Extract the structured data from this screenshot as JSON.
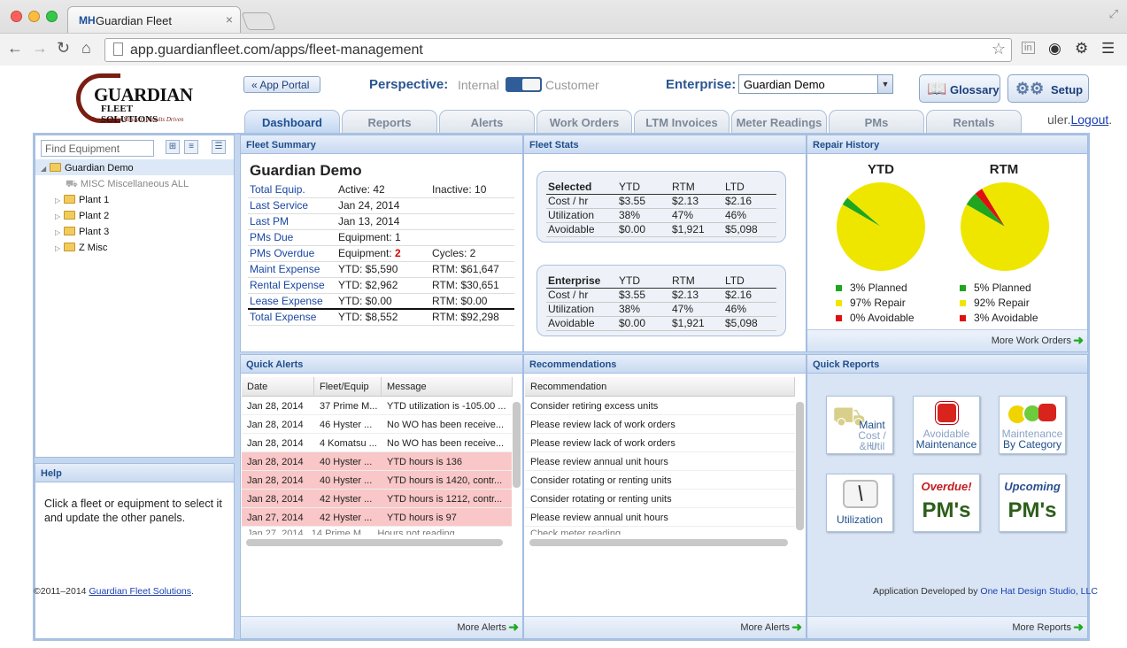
{
  "browser": {
    "tab_title": "Guardian Fleet",
    "tab_favicon": "MH",
    "url": "app.guardianfleet.com/apps/fleet-management"
  },
  "header": {
    "logo_line1": "GUARDIAN",
    "logo_line2": "FLEET SOLUTIONS",
    "logo_line3": "Stewardship Minded | Results Driven",
    "app_portal": "« App Portal",
    "perspective_label": "Perspective:",
    "perspective_internal": "Internal",
    "perspective_customer": "Customer",
    "enterprise_label": "Enterprise:",
    "enterprise_value": "Guardian Demo",
    "glossary": "Glossary",
    "setup": "Setup",
    "user_partial": "uler.",
    "logout": "Logout",
    "logout_dot": "."
  },
  "tabs": [
    "Dashboard",
    "Reports",
    "Alerts",
    "Work Orders",
    "LTM Invoices",
    "Meter Readings",
    "PMs",
    "Rentals"
  ],
  "sidebar": {
    "find_placeholder": "Find Equipment",
    "tree": [
      "Guardian Demo",
      "MISC Miscellaneous ALL",
      "Plant 1",
      "Plant 2",
      "Plant 3",
      "Z Misc"
    ]
  },
  "help": {
    "title": "Help",
    "text": "Click a fleet or equipment to select it and update the other panels."
  },
  "fleet_summary": {
    "title": "Fleet Summary",
    "name": "Guardian Demo",
    "rows": [
      {
        "k": "Total Equip.",
        "v1": "Active: 42",
        "v2": "Inactive: 10"
      },
      {
        "k": "Last Service",
        "v1": "Jan 24, 2014",
        "v2": ""
      },
      {
        "k": "Last PM",
        "v1": "Jan 13, 2014",
        "v2": ""
      },
      {
        "k": "PMs Due",
        "v1": "Equipment: 1",
        "v2": ""
      },
      {
        "k": "PMs Overdue",
        "v1": "Equipment: ",
        "v1b": "2",
        "v2": "Cycles: 2"
      },
      {
        "k": "Maint Expense",
        "v1": "YTD: $5,590",
        "v2": "RTM: $61,647"
      },
      {
        "k": "Rental Expense",
        "v1": "YTD: $2,962",
        "v2": "RTM: $30,651"
      },
      {
        "k": "Lease Expense",
        "v1": "YTD: $0.00",
        "v2": "RTM: $0.00"
      },
      {
        "k": "Total Expense",
        "v1": "YTD: $8,552",
        "v2": "RTM: $92,298"
      }
    ]
  },
  "fleet_stats": {
    "title": "Fleet Stats",
    "tables": [
      {
        "head": [
          "Selected",
          "YTD",
          "RTM",
          "LTD"
        ],
        "rows": [
          [
            "Cost / hr",
            "$3.55",
            "$2.13",
            "$2.16"
          ],
          [
            "Utilization",
            "38%",
            "47%",
            "46%"
          ],
          [
            "Avoidable",
            "$0.00",
            "$1,921",
            "$5,098"
          ]
        ]
      },
      {
        "head": [
          "Enterprise",
          "YTD",
          "RTM",
          "LTD"
        ],
        "rows": [
          [
            "Cost / hr",
            "$3.55",
            "$2.13",
            "$2.16"
          ],
          [
            "Utilization",
            "38%",
            "47%",
            "46%"
          ],
          [
            "Avoidable",
            "$0.00",
            "$1,921",
            "$5,098"
          ]
        ]
      }
    ]
  },
  "repair_history": {
    "title": "Repair History",
    "more": "More Work Orders",
    "colors": {
      "planned": "#1fa51f",
      "repair": "#efe600",
      "avoidable": "#e01010"
    }
  },
  "chart_data": [
    {
      "type": "pie",
      "title": "YTD",
      "categories": [
        "Planned",
        "Repair",
        "Avoidable"
      ],
      "values": [
        3,
        97,
        0
      ],
      "legend": [
        "3% Planned",
        "97% Repair",
        "0% Avoidable"
      ]
    },
    {
      "type": "pie",
      "title": "RTM",
      "categories": [
        "Planned",
        "Repair",
        "Avoidable"
      ],
      "values": [
        5,
        92,
        3
      ],
      "legend": [
        "5% Planned",
        "92% Repair",
        "3% Avoidable"
      ]
    }
  ],
  "quick_alerts": {
    "title": "Quick Alerts",
    "cols": [
      "Date",
      "Fleet/Equip",
      "Message"
    ],
    "rows": [
      {
        "d": "Jan 28, 2014",
        "f": "37 Prime M...",
        "m": "YTD utilization is -105.00 ...",
        "red": false
      },
      {
        "d": "Jan 28, 2014",
        "f": "46 Hyster ...",
        "m": "No WO has been receive...",
        "red": false
      },
      {
        "d": "Jan 28, 2014",
        "f": "4 Komatsu ...",
        "m": "No WO has been receive...",
        "red": false
      },
      {
        "d": "Jan 28, 2014",
        "f": "40 Hyster ...",
        "m": "YTD hours is 136",
        "red": true
      },
      {
        "d": "Jan 28, 2014",
        "f": "40 Hyster ...",
        "m": "YTD hours is 1420, contr...",
        "red": true
      },
      {
        "d": "Jan 28, 2014",
        "f": "42 Hyster ...",
        "m": "YTD hours is 1212, contr...",
        "red": true
      },
      {
        "d": "Jan 27, 2014",
        "f": "42 Hyster ...",
        "m": "YTD hours is 97",
        "red": true
      }
    ],
    "more": "More Alerts"
  },
  "recommendations": {
    "title": "Recommendations",
    "col": "Recommendation",
    "rows": [
      "Consider retiring excess units",
      "Please review lack of work orders",
      "Please review lack of work orders",
      "Please review annual unit hours",
      "Consider rotating or renting units",
      "Consider rotating or renting units",
      "Please review annual unit hours"
    ],
    "more": "More Alerts"
  },
  "quick_reports": {
    "title": "Quick Reports",
    "items": [
      {
        "a": "Maint",
        "b": "Cost / Hr",
        "c": "& Util"
      },
      {
        "a": "Avoidable",
        "b": "Maintenance"
      },
      {
        "a": "Maintenance",
        "b": "By Category"
      },
      {
        "a": "Utilization"
      },
      {
        "a": "Overdue!",
        "b": "PM's"
      },
      {
        "a": "Upcoming",
        "b": "PM's"
      }
    ],
    "more": "More Reports"
  },
  "footer": {
    "copyright": "©2011–2014 ",
    "company": "Guardian Fleet Solutions",
    "period": ".",
    "developed": "Application Developed by ",
    "developer": "One Hat Design Studio, LLC"
  }
}
